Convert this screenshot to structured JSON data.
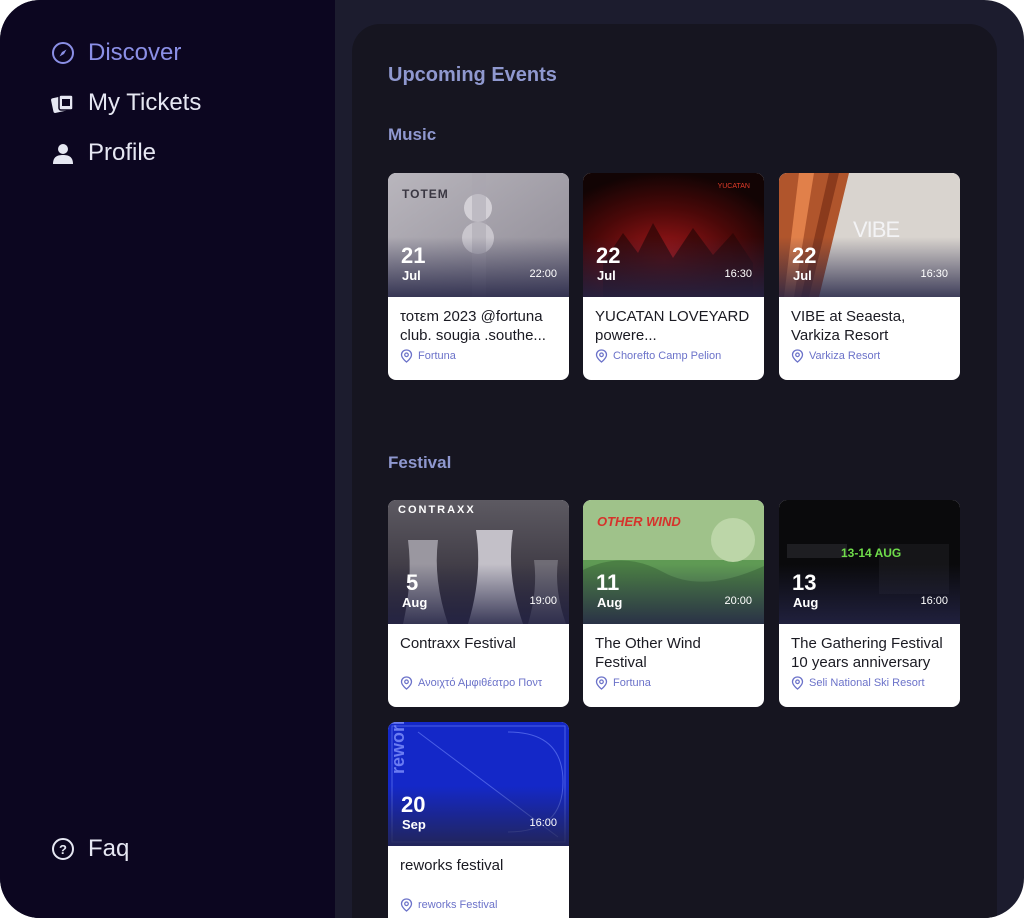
{
  "sidebar": {
    "items": [
      {
        "label": "Discover",
        "icon": "compass-icon",
        "active": true
      },
      {
        "label": "My Tickets",
        "icon": "tickets-icon",
        "active": false
      },
      {
        "label": "Profile",
        "icon": "user-icon",
        "active": false
      }
    ],
    "faq": {
      "label": "Faq",
      "icon": "question-icon"
    }
  },
  "main": {
    "title": "Upcoming Events",
    "sections": [
      {
        "title": "Music",
        "events": [
          {
            "day": "21",
            "month": "Jul",
            "time": "22:00",
            "title": "τοτεm 2023 @fortuna club. sougia .southe...",
            "location": "Fortuna",
            "poster_text": "TOTEM"
          },
          {
            "day": "22",
            "month": "Jul",
            "time": "16:30",
            "title": "YUCATAN LOVEYARD powere...",
            "location": "Chorefto Camp Pelion",
            "poster_text": "YUCATAN"
          },
          {
            "day": "22",
            "month": "Jul",
            "time": "16:30",
            "title": "VIBE at Seaesta, Varkiza Resort",
            "location": "Varkiza Resort",
            "poster_text": "VIBE"
          }
        ]
      },
      {
        "title": "Festival",
        "events": [
          {
            "day": "5",
            "month": "Aug",
            "time": "19:00",
            "title": "Contraxx Festival",
            "location": "Ανοιχτό Αμφιθέατρο Ποντ",
            "poster_text": "CONTRAXX"
          },
          {
            "day": "11",
            "month": "Aug",
            "time": "20:00",
            "title": "The Other Wind Festival",
            "location": "Fortuna",
            "poster_text": "OTHER WIND"
          },
          {
            "day": "13",
            "month": "Aug",
            "time": "16:00",
            "title": "The Gathering Festival 10 years anniversary",
            "location": "Seli National Ski Resort",
            "poster_text": "13-14 AUG"
          },
          {
            "day": "20",
            "month": "Sep",
            "time": "16:00",
            "title": "reworks festival",
            "location": "reworks Festival",
            "poster_text": "reworks"
          }
        ]
      }
    ]
  },
  "colors": {
    "sidebar_bg": "#0c0620",
    "main_bg": "#161520",
    "accent": "#8b8fe6",
    "section_title": "#8f98cf",
    "location_text": "#6b72c9"
  }
}
